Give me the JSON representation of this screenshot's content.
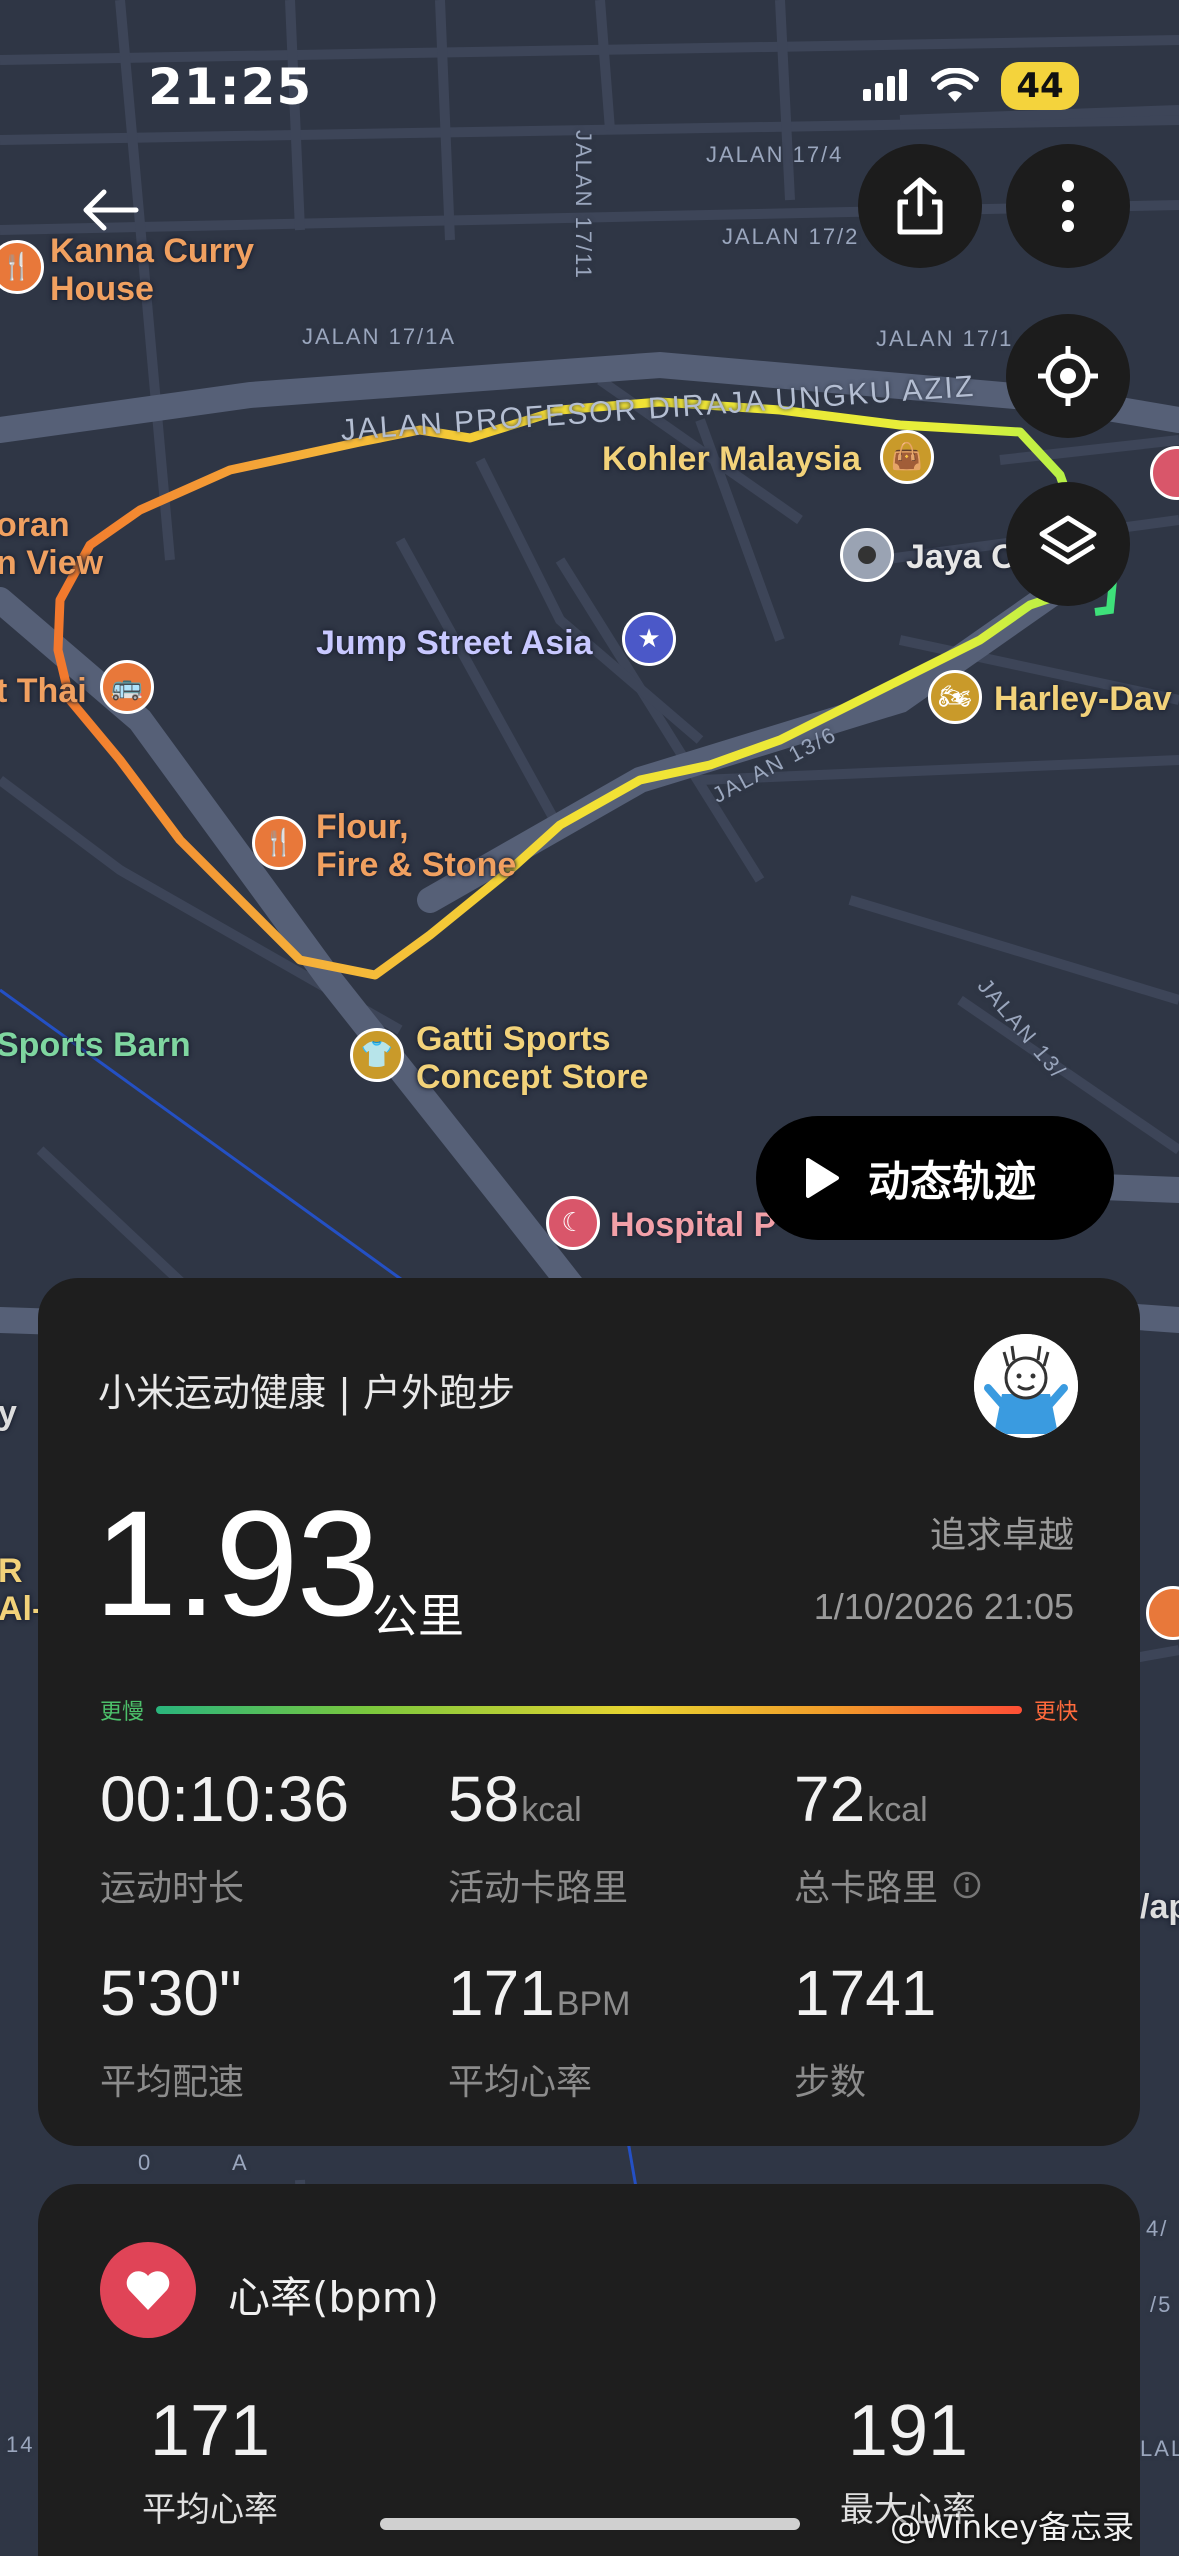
{
  "status_bar": {
    "time": "21:25",
    "battery": "44"
  },
  "map": {
    "places": {
      "kanna": "Kanna Curry House",
      "kanna_l1": "Kanna Curry",
      "kanna_l2": "House",
      "kohler": "Kohler Malaysia",
      "jaya": "Jaya C",
      "jump": "Jump Street Asia",
      "harley": "Harley-Dav",
      "oran": "oran",
      "nview": "n View",
      "thai": "t Thai",
      "flour_l1": "Flour,",
      "flour_l2": "Fire & Stone",
      "sports_barn": "Sports Barn",
      "gatti_l1": "Gatti Sports",
      "gatti_l2": "Concept Store",
      "hospital": "Hospital P",
      "edge_y": "y",
      "edge_r1": "R",
      "edge_r2": "Al-",
      "edge_ap": "/ap"
    },
    "streets": {
      "s1711": "JALAN 17/11",
      "s174": "JALAN 17/4",
      "s172": "JALAN 17/2",
      "s171a": "JALAN 17/1A",
      "s171": "JALAN 17/1",
      "profesor": "JALAN PROFESOR DIRAJA UNGKU AZIZ",
      "s136": "JALAN 13/6",
      "s13": "JALAN 13/",
      "edge_a": "A",
      "edge_0": "0",
      "edge_l": "LAL",
      "edge_14": "14",
      "edge_4": "4/",
      "edge_5": "/5"
    }
  },
  "replay_button": {
    "label": "动态轨迹"
  },
  "summary": {
    "app_title": "小米运动健康 | 户外跑步",
    "distance": "1.93",
    "distance_unit": "公里",
    "motto": "追求卓越",
    "datetime": "1/10/2026 21:05",
    "pace_scale": {
      "slow": "更慢",
      "fast": "更快"
    },
    "stats": [
      {
        "value": "00:10:36",
        "unit": "",
        "label": "运动时长"
      },
      {
        "value": "58",
        "unit": "kcal",
        "label": "活动卡路里"
      },
      {
        "value": "72",
        "unit": "kcal",
        "label": "总卡路里"
      },
      {
        "value": "5'30\"",
        "unit": "",
        "label": "平均配速"
      },
      {
        "value": "171",
        "unit": "BPM",
        "label": "平均心率"
      },
      {
        "value": "1741",
        "unit": "",
        "label": "步数"
      }
    ]
  },
  "heart_rate": {
    "title": "心率(bpm)",
    "avg": {
      "value": "171",
      "label": "平均心率"
    },
    "max": {
      "value": "191",
      "label": "最大心率"
    }
  },
  "watermark": "@Winkey备忘录",
  "colors": {
    "card": "#1e1e1e",
    "map_bg": "#2f3645",
    "heart": "#e04457",
    "battery": "#f4d33c"
  }
}
